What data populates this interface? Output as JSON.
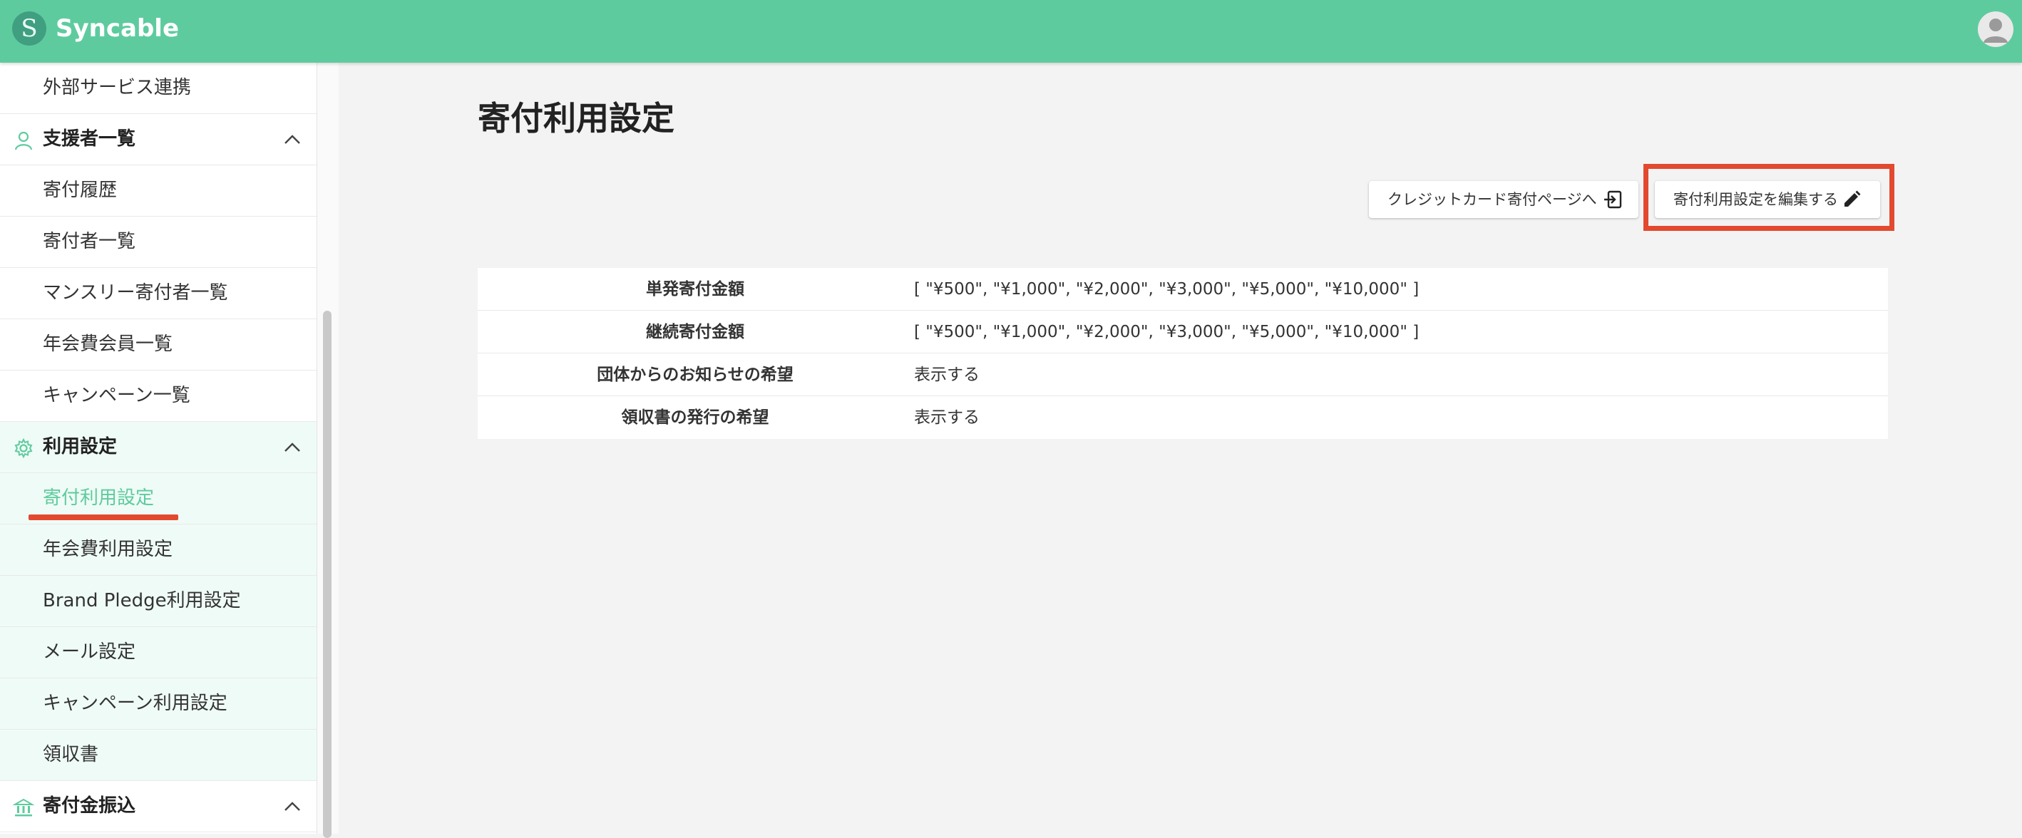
{
  "app": {
    "brand": "Syncable",
    "logo_letter": "S"
  },
  "sidebar": {
    "items": [
      {
        "label": "外部サービス連携",
        "type": "item"
      },
      {
        "label": "支援者一覧",
        "type": "group",
        "icon": "person-icon"
      },
      {
        "label": "寄付履歴",
        "type": "item"
      },
      {
        "label": "寄付者一覧",
        "type": "item"
      },
      {
        "label": "マンスリー寄付者一覧",
        "type": "item"
      },
      {
        "label": "年会費会員一覧",
        "type": "item"
      },
      {
        "label": "キャンペーン一覧",
        "type": "item"
      },
      {
        "label": "利用設定",
        "type": "group",
        "icon": "gear-icon"
      },
      {
        "label": "寄付利用設定",
        "type": "item",
        "active": true
      },
      {
        "label": "年会費利用設定",
        "type": "item"
      },
      {
        "label": "Brand Pledge利用設定",
        "type": "item"
      },
      {
        "label": "メール設定",
        "type": "item"
      },
      {
        "label": "キャンペーン利用設定",
        "type": "item"
      },
      {
        "label": "領収書",
        "type": "item"
      },
      {
        "label": "寄付金振込",
        "type": "group",
        "icon": "bank-icon"
      }
    ]
  },
  "main": {
    "title": "寄付利用設定",
    "buttons": {
      "credit_page": "クレジットカード寄付ページへ",
      "edit": "寄付利用設定を編集する"
    },
    "settings": [
      {
        "key": "単発寄付金額",
        "value": "[ \"¥500\", \"¥1,000\", \"¥2,000\", \"¥3,000\", \"¥5,000\", \"¥10,000\" ]"
      },
      {
        "key": "継続寄付金額",
        "value": "[ \"¥500\", \"¥1,000\", \"¥2,000\", \"¥3,000\", \"¥5,000\", \"¥10,000\" ]"
      },
      {
        "key": "団体からのお知らせの希望",
        "value": "表示する"
      },
      {
        "key": "領収書の発行の希望",
        "value": "表示する"
      }
    ]
  },
  "colors": {
    "accent": "#5ecb9f",
    "highlight": "#e2492f"
  }
}
